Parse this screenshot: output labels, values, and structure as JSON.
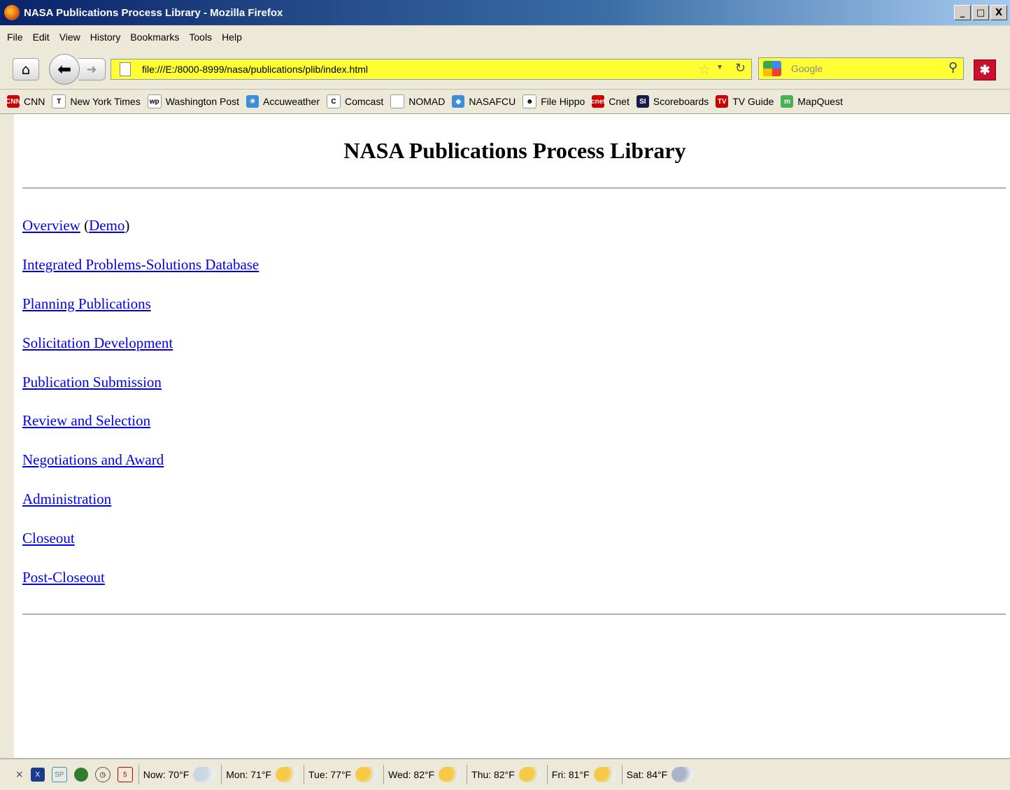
{
  "window": {
    "title": "NASA Publications Process Library - Mozilla Firefox",
    "controls": [
      "_",
      "□",
      "X"
    ]
  },
  "menu": [
    "File",
    "Edit",
    "View",
    "History",
    "Bookmarks",
    "Tools",
    "Help"
  ],
  "navigation": {
    "url": "file:///E:/8000-8999/nasa/publications/plib/index.html",
    "search_placeholder": "Google"
  },
  "bookmarks": [
    {
      "label": "CNN",
      "icon": "cnn-icon",
      "color": "#cc0000",
      "glyph": "CNN"
    },
    {
      "label": "New York Times",
      "icon": "nyt-icon",
      "color": "#ffffff",
      "glyph": "T"
    },
    {
      "label": "Washington Post",
      "icon": "wp-icon",
      "color": "#ffffff",
      "glyph": "wp"
    },
    {
      "label": "Accuweather",
      "icon": "accuweather-icon",
      "color": "#3a8fd8",
      "glyph": "☀"
    },
    {
      "label": "Comcast",
      "icon": "comcast-icon",
      "color": "#ffffff",
      "glyph": "C"
    },
    {
      "label": "NOMAD",
      "icon": "page-icon",
      "color": "#ffffff",
      "glyph": ""
    },
    {
      "label": "NASAFCU",
      "icon": "nasafcu-icon",
      "color": "#3a8fd8",
      "glyph": "◆"
    },
    {
      "label": "File Hippo",
      "icon": "filehippo-icon",
      "color": "#ffffff",
      "glyph": "☻"
    },
    {
      "label": "Cnet",
      "icon": "cnet-icon",
      "color": "#cc0000",
      "glyph": "cnet"
    },
    {
      "label": "Scoreboards",
      "icon": "si-icon",
      "color": "#1a1a4a",
      "glyph": "SI"
    },
    {
      "label": "TV Guide",
      "icon": "tvguide-icon",
      "color": "#cc0000",
      "glyph": "TV"
    },
    {
      "label": "MapQuest",
      "icon": "mapquest-icon",
      "color": "#4caf50",
      "glyph": "m"
    }
  ],
  "page": {
    "title": "NASA Publications Process Library",
    "overview": {
      "label": "Overview",
      "demo": "Demo",
      "open_paren": "(",
      "close_paren": ")"
    },
    "links": [
      "Integrated Problems-Solutions Database",
      "Planning Publications",
      "Solicitation Development",
      "Publication Submission",
      "Review and Selection",
      "Negotiations and Award",
      "Administration",
      "Closeout",
      "Post-Closeout"
    ]
  },
  "statusbar": {
    "calendar_day": "5",
    "weather": [
      "Now: 70°F",
      "Mon: 71°F",
      "Tue: 77°F",
      "Wed: 82°F",
      "Thu: 82°F",
      "Fri: 81°F",
      "Sat: 84°F"
    ]
  },
  "colors": {
    "link": "#0000ee",
    "urlbar": "#ffff33",
    "titlebar": "#0a246a"
  }
}
